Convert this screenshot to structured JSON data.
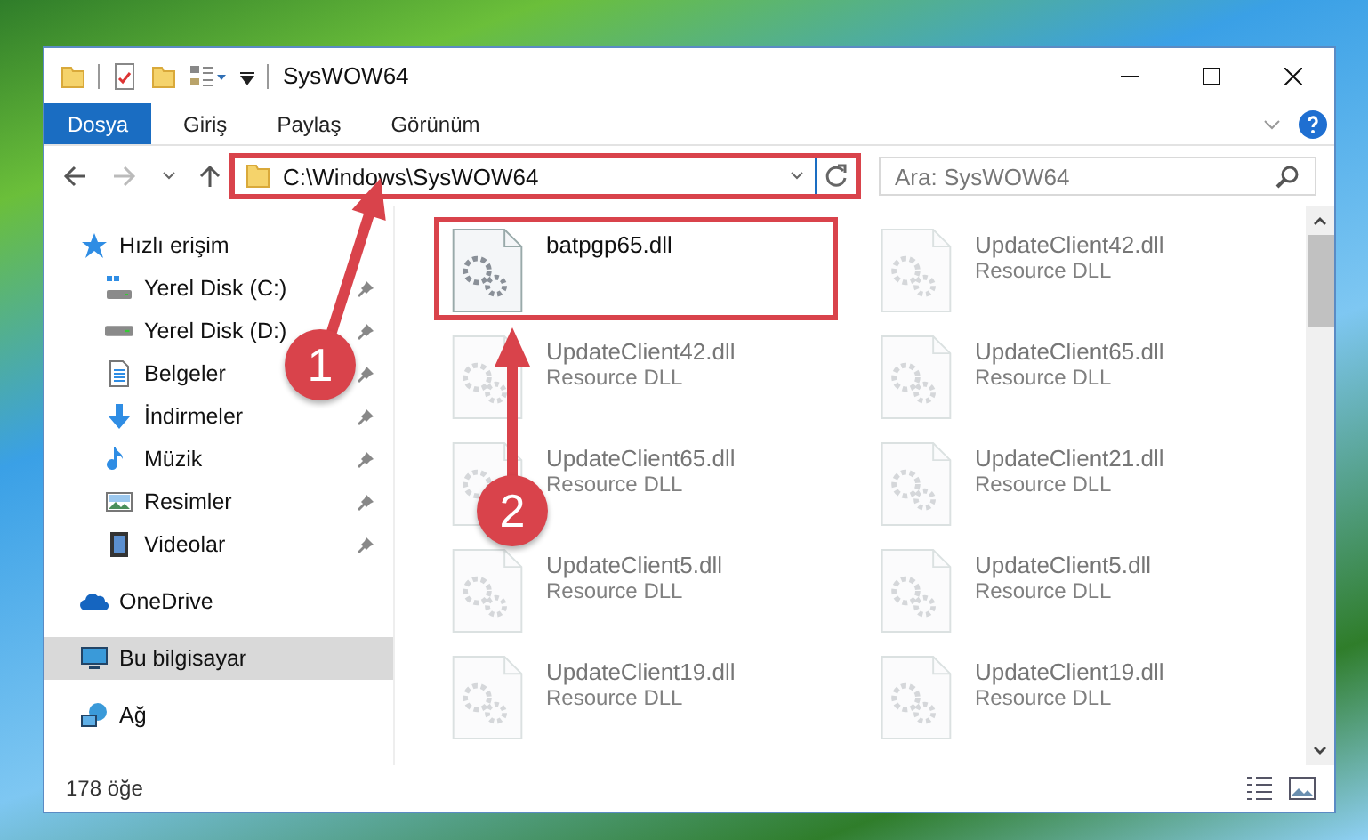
{
  "window": {
    "title": "SysWOW64"
  },
  "ribbon_tabs": [
    {
      "label": "Dosya",
      "selected": true
    },
    {
      "label": "Giriş",
      "selected": false
    },
    {
      "label": "Paylaş",
      "selected": false
    },
    {
      "label": "Görünüm",
      "selected": false
    }
  ],
  "address_bar": {
    "path": "C:\\Windows\\SysWOW64",
    "highlighted": true
  },
  "search": {
    "placeholder": "Ara: SysWOW64"
  },
  "sidebar": {
    "items": [
      {
        "label": "Hızlı erişim",
        "kind": "star",
        "selected": false,
        "children": [
          {
            "label": "Yerel Disk (C:)",
            "kind": "system-disk",
            "pinned": true,
            "selected": false
          },
          {
            "label": "Yerel Disk (D:)",
            "kind": "disk",
            "pinned": true,
            "selected": false
          },
          {
            "label": "Belgeler",
            "kind": "document",
            "pinned": true,
            "selected": false
          },
          {
            "label": "İndirmeler",
            "kind": "download",
            "pinned": true,
            "selected": false
          },
          {
            "label": "Müzik",
            "kind": "music",
            "pinned": true,
            "selected": false
          },
          {
            "label": "Resimler",
            "kind": "picture",
            "pinned": true,
            "selected": false
          },
          {
            "label": "Videolar",
            "kind": "video",
            "pinned": true,
            "selected": false
          }
        ]
      },
      {
        "label": "OneDrive",
        "kind": "cloud",
        "selected": false
      },
      {
        "label": "Bu bilgisayar",
        "kind": "computer",
        "selected": true
      },
      {
        "label": "Ağ",
        "kind": "network",
        "selected": false
      }
    ]
  },
  "files": [
    {
      "name": "batpgp65.dll",
      "highlighted": true,
      "dimmed": false
    },
    {
      "name": "UpdateClient42.dll",
      "type": "Resource DLL",
      "highlighted": false,
      "dimmed": true
    },
    {
      "name": "UpdateClient65.dll",
      "type": "Resource DLL",
      "highlighted": false,
      "dimmed": true
    },
    {
      "name": "UpdateClient5.dll",
      "type": "Resource DLL",
      "highlighted": false,
      "dimmed": true
    },
    {
      "name": "UpdateClient19.dll",
      "type": "Resource DLL",
      "highlighted": false,
      "dimmed": true
    },
    {
      "name": "UpdateClient42.dll",
      "type": "Resource DLL",
      "highlighted": false,
      "dimmed": true
    },
    {
      "name": "UpdateClient65.dll",
      "type": "Resource DLL",
      "highlighted": false,
      "dimmed": true
    },
    {
      "name": "UpdateClient21.dll",
      "type": "Resource DLL",
      "highlighted": false,
      "dimmed": true
    },
    {
      "name": "UpdateClient5.dll",
      "type": "Resource DLL",
      "highlighted": false,
      "dimmed": true
    },
    {
      "name": "UpdateClient19.dll",
      "type": "Resource DLL",
      "highlighted": false,
      "dimmed": true
    }
  ],
  "callouts": [
    {
      "number": "1"
    },
    {
      "number": "2"
    }
  ],
  "status_bar": {
    "count": "178 öğe"
  }
}
